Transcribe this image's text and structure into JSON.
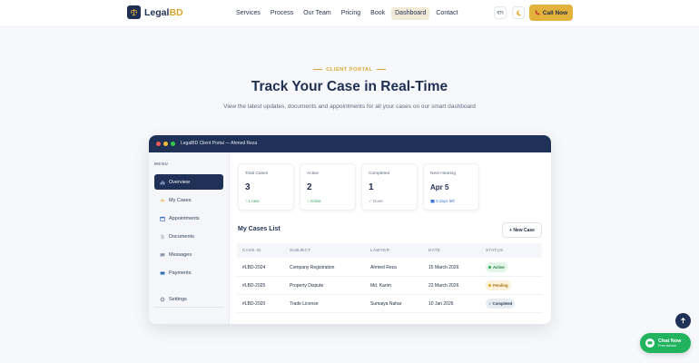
{
  "brand": {
    "name_main": "Legal",
    "name_accent": "BD"
  },
  "nav": {
    "links": [
      "Services",
      "Process",
      "Our Team",
      "Pricing",
      "Book",
      "Dashboard",
      "Contact"
    ],
    "active": "Dashboard",
    "lang_label": "বাং",
    "call_label": "Call Now"
  },
  "hero": {
    "eyebrow": "CLIENT PORTAL",
    "title": "Track Your Case in Real-Time",
    "subtitle": "View the latest updates, documents and appointments for all your cases on our smart dashboard"
  },
  "portal": {
    "window_title": "LegalBD Client Portal — Ahmed Reza",
    "menu_label": "MENU",
    "sidebar": [
      {
        "label": "Overview",
        "icon": "chart-icon",
        "active": true
      },
      {
        "label": "My Cases",
        "icon": "scale-icon",
        "active": false
      },
      {
        "label": "Appointments",
        "icon": "calendar-icon",
        "active": false
      },
      {
        "label": "Documents",
        "icon": "document-icon",
        "active": false
      },
      {
        "label": "Messages",
        "icon": "message-icon",
        "active": false
      },
      {
        "label": "Payments",
        "icon": "card-icon",
        "active": false
      }
    ],
    "settings_label": "Settings",
    "stats": [
      {
        "label": "Total Cases",
        "value": "3",
        "note": "↑ 1 new"
      },
      {
        "label": "Active",
        "value": "2",
        "note": "↑ Active"
      },
      {
        "label": "Completed",
        "value": "1",
        "note": "✓ Done"
      },
      {
        "label": "Next Hearing",
        "value": "Apr 5",
        "note": "5 days left"
      }
    ],
    "cases_title": "My Cases List",
    "new_case_label": "+ New Case",
    "table": {
      "headers": [
        "CASE ID",
        "SUBJECT",
        "LAWYER",
        "DATE",
        "STATUS"
      ],
      "rows": [
        {
          "id": "#LBD-2024",
          "subject": "Company Registration",
          "lawyer": "Ahmed Reza",
          "date": "15 March 2026",
          "status": "Active"
        },
        {
          "id": "#LBD-2025",
          "subject": "Property Dispute",
          "lawyer": "Md. Karim",
          "date": "22 March 2026",
          "status": "Pending"
        },
        {
          "id": "#LBD-2020",
          "subject": "Trade License",
          "lawyer": "Sumaiya Nahar",
          "date": "10 Jan 2026",
          "status": "✓ Completed"
        }
      ]
    }
  },
  "chat": {
    "main": "Chat Now",
    "sub": "Free Advice"
  },
  "colors": {
    "navy": "#1f3156",
    "gold": "#d9a72f",
    "green": "#22b35e"
  }
}
